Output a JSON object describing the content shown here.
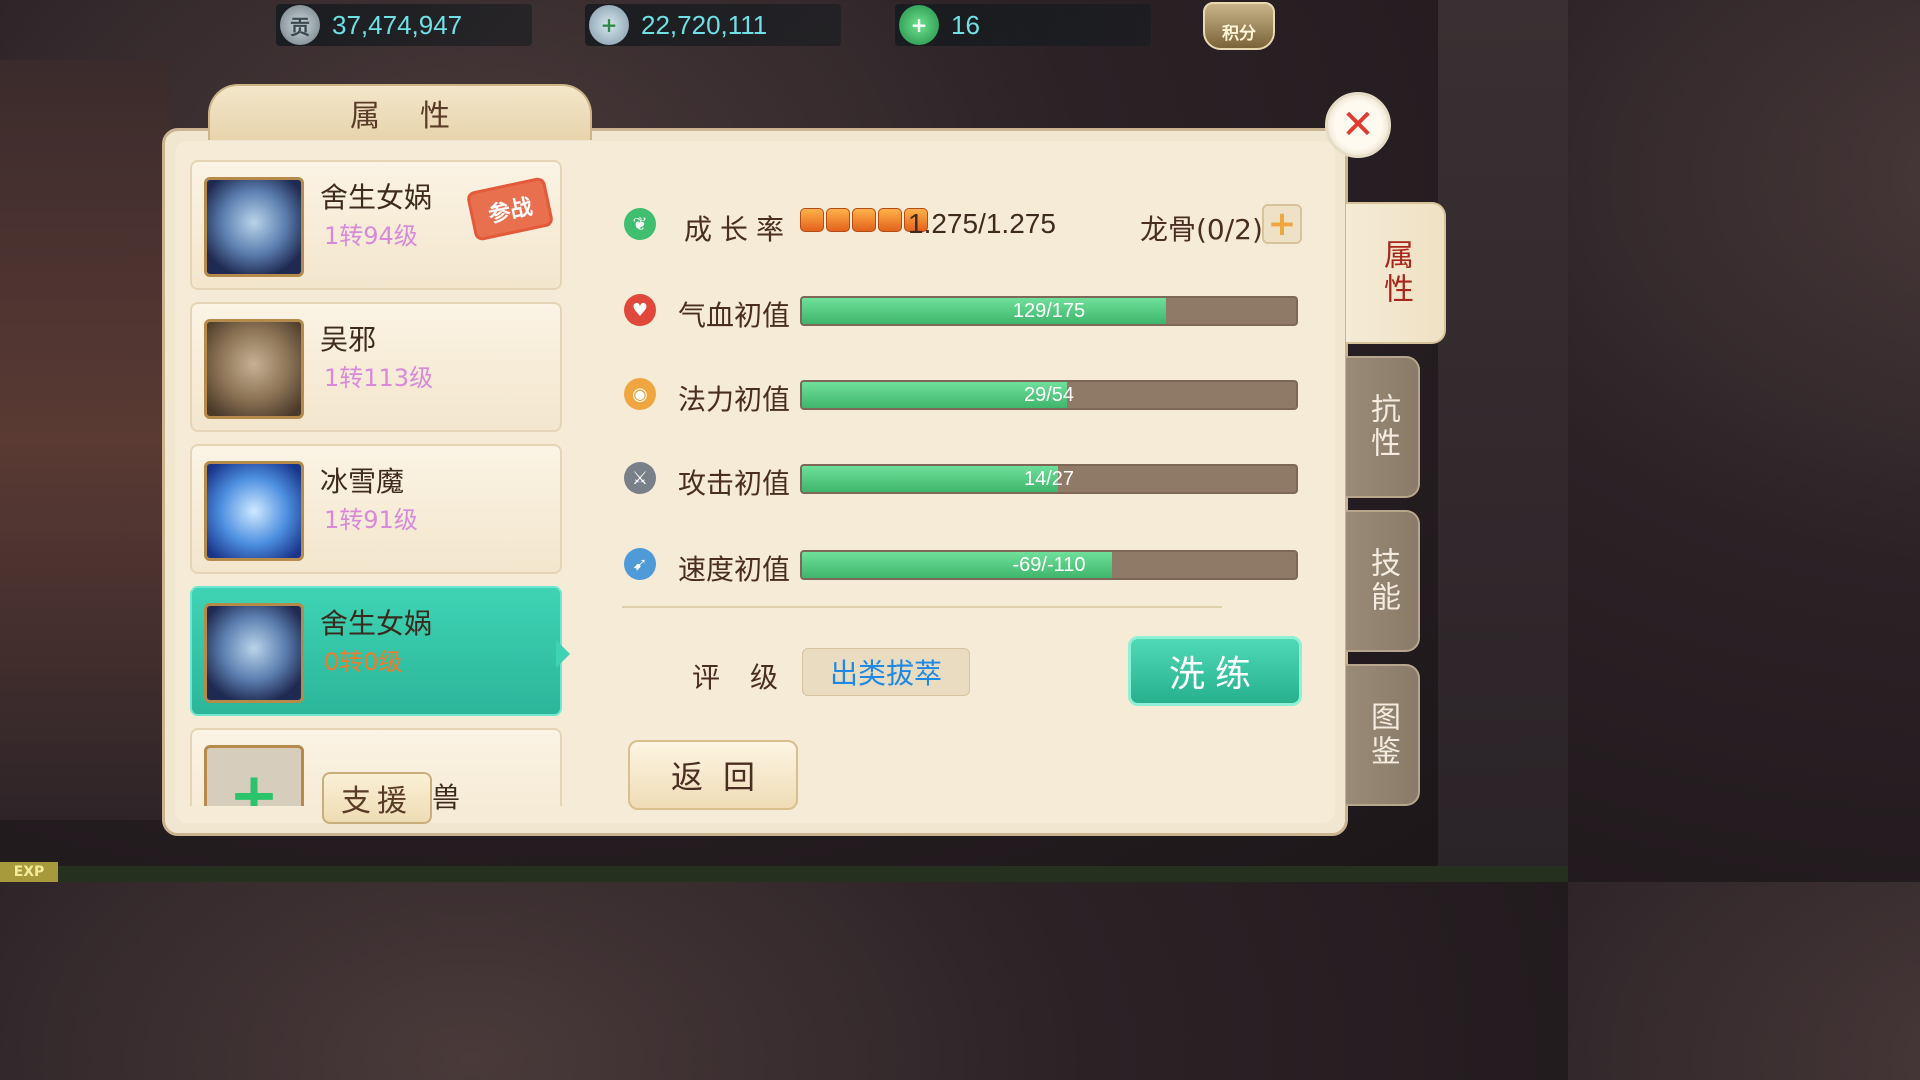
{
  "currencies": [
    {
      "icon": "gong-coin-icon",
      "symbol": "贡",
      "value": "37,474,947"
    },
    {
      "icon": "silver-ingot-icon",
      "symbol": "",
      "value": "22,720,111"
    },
    {
      "icon": "jade-icon",
      "symbol": "",
      "value": "16"
    }
  ],
  "score_button": "积分",
  "panel_title": "属性",
  "side_tabs": [
    "属性",
    "抗性",
    "技能",
    "图鉴"
  ],
  "pets": [
    {
      "name": "舍生女娲",
      "level": "1转94级",
      "badge": "参战",
      "avatar": "nvwa"
    },
    {
      "name": "吴邪",
      "level": "1转113级",
      "avatar": "wuxie"
    },
    {
      "name": "冰雪魔",
      "level": "1转91级",
      "avatar": "ice-demon"
    },
    {
      "name": "舍生女娲",
      "level": "0转0级",
      "avatar": "nvwa",
      "selected": true
    }
  ],
  "support": {
    "button": "支援",
    "tail_text": "兽"
  },
  "growth": {
    "label": "成长率",
    "stars": 5,
    "value": "1.275/1.275"
  },
  "dragonbone": "龙骨(0/2)",
  "stats": [
    {
      "label": "气血初值",
      "text": "129/175",
      "current": 129,
      "max": 175,
      "icon": "heart-icon",
      "color": "#e2473b"
    },
    {
      "label": "法力初值",
      "text": "29/54",
      "current": 29,
      "max": 54,
      "icon": "mana-icon",
      "color": "#f0a640"
    },
    {
      "label": "攻击初值",
      "text": "14/27",
      "current": 14,
      "max": 27,
      "icon": "sword-icon",
      "color": "#8a8f99"
    },
    {
      "label": "速度初值",
      "text": "-69/-110",
      "current": 69,
      "max": 110,
      "icon": "speed-icon",
      "color": "#4f9ad8"
    }
  ],
  "rating": {
    "label": "评级",
    "value": "出类拔萃"
  },
  "buttons": {
    "wash": "洗练",
    "back": "返回"
  },
  "exp_label": "EXP"
}
